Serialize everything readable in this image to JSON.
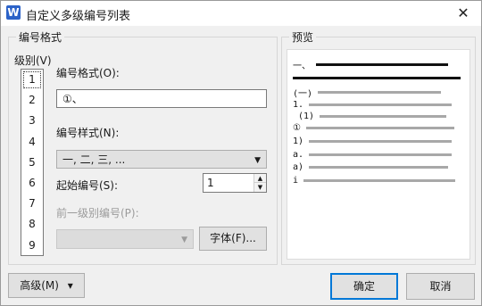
{
  "window": {
    "title": "自定义多级编号列表",
    "app_icon": "W",
    "close_icon": "✕"
  },
  "left_group": {
    "legend": "编号格式",
    "level_label": "级别(V)",
    "levels": [
      "1",
      "2",
      "3",
      "4",
      "5",
      "6",
      "7",
      "8",
      "9"
    ],
    "selected_level": "1",
    "format_label": "编号格式(O):",
    "format_value": "①、",
    "style_label": "编号样式(N):",
    "style_value": "一, 二, 三, ...",
    "start_label": "起始编号(S):",
    "start_value": "1",
    "prev_level_label": "前一级别编号(P):",
    "prev_level_value": "",
    "font_button": "字体(F)..."
  },
  "preview": {
    "legend": "预览",
    "rows": [
      "一、",
      "(一)",
      "1.",
      "(1)",
      "①",
      "1)",
      "a.",
      "a)",
      "i"
    ]
  },
  "footer": {
    "advanced_button": "高级(M)",
    "advanced_arrow": "▾",
    "ok_button": "确定",
    "cancel_button": "取消"
  }
}
